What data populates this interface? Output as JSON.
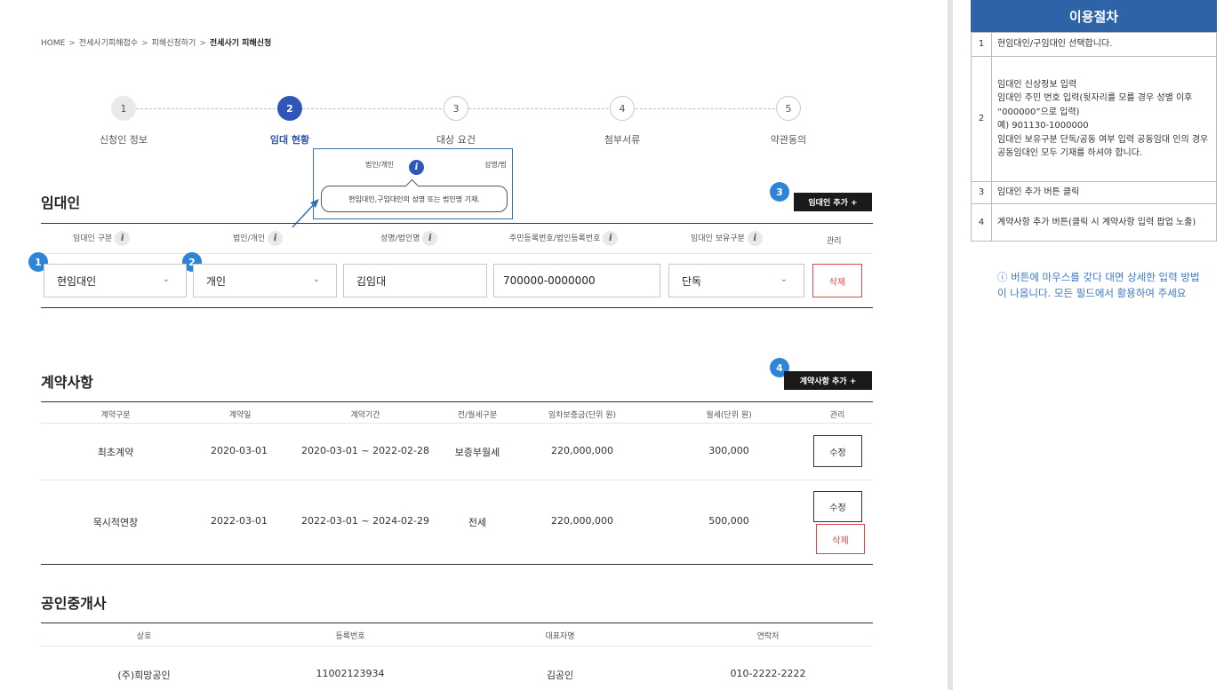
{
  "breadcrumb": {
    "home": "HOME",
    "sep": ">",
    "item1": "전세사기피해접수",
    "item2": "피해신청하기",
    "current": "전세사기 피해신청"
  },
  "steps": [
    {
      "num": "1",
      "label": "신청인 정보"
    },
    {
      "num": "2",
      "label": "임대 현황"
    },
    {
      "num": "3",
      "label": "대상 요건"
    },
    {
      "num": "4",
      "label": "첨부서류"
    },
    {
      "num": "5",
      "label": "약관동의"
    }
  ],
  "popup": {
    "header1": "법인/개인",
    "header2": "성명/법",
    "tip": "현임대인,구임대인의 성명 또는 법인명 기재."
  },
  "info_glyph": "i",
  "lessor": {
    "title": "임대인",
    "add_button": "임대인 추가 +",
    "badge_add": "3",
    "badge_type": "1",
    "badge_corp": "2",
    "headers": [
      "임대인 구분",
      "법인/개인",
      "성명/법인명",
      "주민등록번호/법인등록번호",
      "임대인 보유구분",
      "관리"
    ],
    "row": {
      "type": "현임대인",
      "corp": "개인",
      "name": "김임대",
      "id_number": "700000-0000000",
      "ownership": "단독",
      "delete": "삭제"
    },
    "chevron": "⌄"
  },
  "contract": {
    "title": "계약사항",
    "add_button": "계약사항 추가 +",
    "badge_add": "4",
    "headers": [
      "계약구분",
      "계약일",
      "계약기간",
      "전/월세구분",
      "임차보증금(단위 원)",
      "월세(단위 원)",
      "관리"
    ],
    "rows": [
      {
        "kind": "최초계약",
        "date": "2020-03-01",
        "period": "2020-03-01 ~ 2022-02-28",
        "rent_type": "보증부월세",
        "deposit": "220,000,000",
        "monthly": "300,000",
        "edit": "수정"
      },
      {
        "kind": "묵시적연장",
        "date": "2022-03-01",
        "period": "2022-03-01 ~ 2024-02-29",
        "rent_type": "전세",
        "deposit": "220,000,000",
        "monthly": "500,000",
        "edit": "수정",
        "delete": "삭제"
      }
    ]
  },
  "broker": {
    "title": "공인중개사",
    "headers": [
      "상호",
      "등록번호",
      "대표자명",
      "연락처"
    ],
    "row": {
      "name": "(주)희망공인",
      "reg": "11002123934",
      "rep": "김공인",
      "phone": "010-2222-2222"
    }
  },
  "procedure": {
    "title": "이용절차",
    "items": [
      {
        "num": "1",
        "lines": [
          "현임대인/구임대인 선택합니다."
        ]
      },
      {
        "num": "2",
        "lines": [
          "임대인 신상정보 입력",
          "임대인 주민 번호 입력(뒷자리를 모를 경우 성별 이후 “000000”으로 입력)",
          "예) 901130-1000000",
          "임대인 보유구분 단독/공동 여부 입력 공동임대 인의 경우 공동임대인 모두 기재를 하셔야 합니다."
        ]
      },
      {
        "num": "3",
        "lines": [
          "임대인 추가 버튼 클릭"
        ]
      },
      {
        "num": "4",
        "lines": [
          "계약사항 추가 버튼(클릭 시 계약사항 입력 팝업 노출)"
        ]
      }
    ],
    "note": "ⓘ 버튼에 마우스를 갖다 대면 상세한 입력 방법이 나옵니다. 모든 필드에서 활용하여 주세요"
  }
}
